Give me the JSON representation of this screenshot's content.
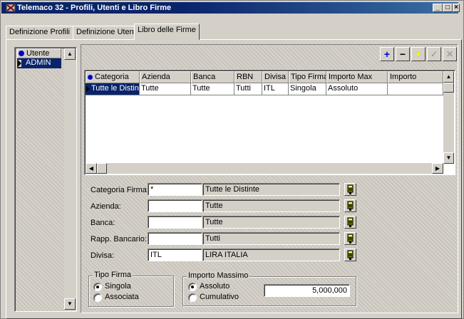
{
  "window": {
    "title": "Telemaco 32 - Profili, Utenti e Libro Firme",
    "controls": {
      "minimize": "_",
      "maximize": "□",
      "close": "×"
    }
  },
  "tabs": [
    {
      "label": "Definizione Profili"
    },
    {
      "label": "Definizione Utenti"
    },
    {
      "label": "Libro delle Firme"
    }
  ],
  "users_list": {
    "header": "Utente",
    "items": [
      "ADMIN"
    ]
  },
  "toolbar": {
    "add_label": "+",
    "remove_label": "−",
    "up_label": "▲",
    "confirm_label": "✓",
    "cancel_label": "✕"
  },
  "grid": {
    "columns": [
      "Categoria",
      "Azienda",
      "Banca",
      "RBN",
      "Divisa",
      "Tipo Firma",
      "Importo Max",
      "Importo"
    ],
    "rows": [
      [
        "Tutte le Distinte",
        "Tutte",
        "Tutte",
        "Tutti",
        "ITL",
        "Singola",
        "Assoluto",
        ""
      ]
    ]
  },
  "form": {
    "categoria": {
      "label": "Categoria Firma:",
      "code": "*",
      "desc": "Tutte le Distinte"
    },
    "azienda": {
      "label": "Azienda:",
      "code": "",
      "desc": "Tutte"
    },
    "banca": {
      "label": "Banca:",
      "code": "",
      "desc": "Tutte"
    },
    "rapp": {
      "label": "Rapp. Bancario:",
      "code": "",
      "desc": "Tutti"
    },
    "divisa": {
      "label": "Divisa:",
      "code": "ITL",
      "desc": "LIRA ITALIA"
    }
  },
  "tipo_firma": {
    "legend": "Tipo Firma",
    "options": [
      "Singola",
      "Associata"
    ],
    "selected": "Singola"
  },
  "importo_massimo": {
    "legend": "Importo Massimo",
    "options": [
      "Assoluto",
      "Cumulativo"
    ],
    "selected": "Assoluto",
    "value": "5,000,000"
  },
  "colors": {
    "titlebar": "#0a246a",
    "face": "#d4d0c8",
    "selection": "#0a246a",
    "add_icon": "#0000cc",
    "up_icon": "#ffff00"
  }
}
